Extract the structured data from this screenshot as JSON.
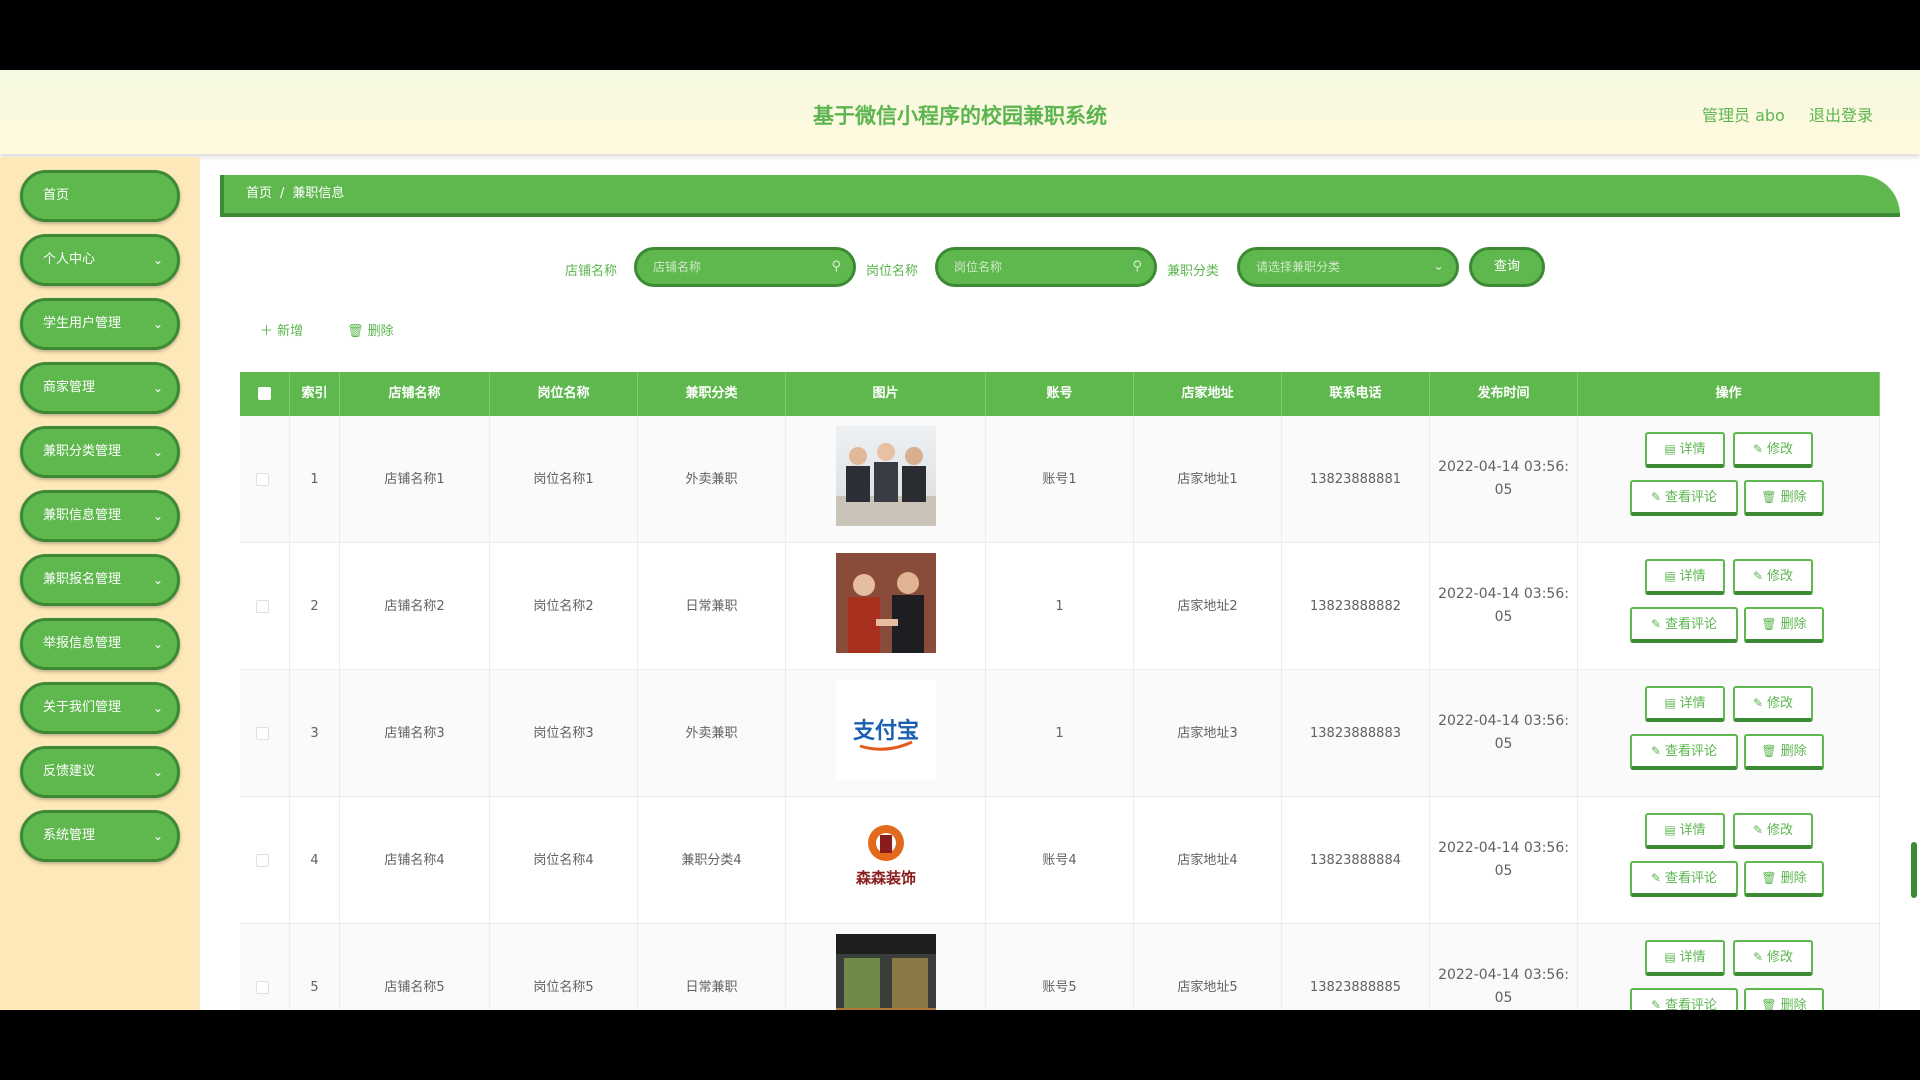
{
  "header": {
    "title": "基于微信小程序的校园兼职系统",
    "user": "管理员 abo",
    "logout": "退出登录"
  },
  "sidebar": [
    {
      "label": "首页",
      "icon": ""
    },
    {
      "label": "个人中心",
      "icon": "chevron-down-icon"
    },
    {
      "label": "学生用户管理",
      "icon": "chevron-down-icon"
    },
    {
      "label": "商家管理",
      "icon": "chevron-down-icon"
    },
    {
      "label": "兼职分类管理",
      "icon": "chevron-down-icon"
    },
    {
      "label": "兼职信息管理",
      "icon": "chevron-down-icon"
    },
    {
      "label": "兼职报名管理",
      "icon": "chevron-down-icon"
    },
    {
      "label": "举报信息管理",
      "icon": "chevron-down-icon"
    },
    {
      "label": "关于我们管理",
      "icon": "chevron-down-icon"
    },
    {
      "label": "反馈建议",
      "icon": "chevron-down-icon"
    },
    {
      "label": "系统管理",
      "icon": "chevron-down-icon"
    }
  ],
  "breadcrumb": {
    "home": "首页",
    "sep": "/",
    "current": "兼职信息"
  },
  "search": {
    "shop_label": "店铺名称",
    "shop_placeholder": "店铺名称",
    "post_label": "岗位名称",
    "post_placeholder": "岗位名称",
    "cat_label": "兼职分类",
    "cat_placeholder": "请选择兼职分类",
    "query": "查询"
  },
  "toolbar": {
    "add": "新增",
    "delete": "删除"
  },
  "table": {
    "headers": [
      "索引",
      "店铺名称",
      "岗位名称",
      "兼职分类",
      "图片",
      "账号",
      "店家地址",
      "联系电话",
      "发布时间",
      "操作"
    ],
    "actions": {
      "detail": "详情",
      "edit": "修改",
      "comments": "查看评论",
      "delete": "删除"
    },
    "rows": [
      {
        "index": "1",
        "shop": "店铺名称1",
        "post": "岗位名称1",
        "category": "外卖兼职",
        "image": "business-people-photo",
        "account": "账号1",
        "address": "店家地址1",
        "phone": "13823888881",
        "time": "2022-04-14 03:56:\n05"
      },
      {
        "index": "2",
        "shop": "店铺名称2",
        "post": "岗位名称2",
        "category": "日常兼职",
        "image": "handshake-photo",
        "account": "1",
        "address": "店家地址2",
        "phone": "13823888882",
        "time": "2022-04-14 03:56:\n05"
      },
      {
        "index": "3",
        "shop": "店铺名称3",
        "post": "岗位名称3",
        "category": "外卖兼职",
        "image": "alipay-logo",
        "image_text": "支付宝",
        "account": "1",
        "address": "店家地址3",
        "phone": "13823888883",
        "time": "2022-04-14 03:56:\n05"
      },
      {
        "index": "4",
        "shop": "店铺名称4",
        "post": "岗位名称4",
        "category": "兼职分类4",
        "image": "decoration-logo",
        "image_text": "森森装饰",
        "account": "账号4",
        "address": "店家地址4",
        "phone": "13823888884",
        "time": "2022-04-14 03:56:\n05"
      },
      {
        "index": "5",
        "shop": "店铺名称5",
        "post": "岗位名称5",
        "category": "日常兼职",
        "image": "store-interior-photo",
        "account": "账号5",
        "address": "店家地址5",
        "phone": "13823888885",
        "time": "2022-04-14 03:56:\n05"
      }
    ]
  },
  "colors": {
    "green": "#5fb84d",
    "dark_green": "#3d8a35",
    "sidebar_bg": "#fde8b9"
  }
}
